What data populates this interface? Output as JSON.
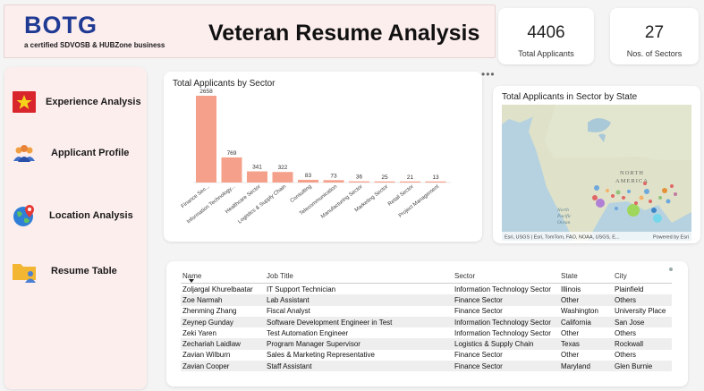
{
  "header": {
    "logo": "BOTG",
    "logo_tagline": "a certified SDVOSB & HUBZone business",
    "title": "Veteran Resume Analysis"
  },
  "kpis": [
    {
      "value": "4406",
      "label": "Total Applicants"
    },
    {
      "value": "27",
      "label": "Nos. of Sectors"
    }
  ],
  "nav": [
    {
      "label": "Experience Analysis",
      "icon": "star-flag-icon"
    },
    {
      "label": "Applicant Profile",
      "icon": "people-group-icon"
    },
    {
      "label": "Location Analysis",
      "icon": "globe-pin-icon"
    },
    {
      "label": "Resume Table",
      "icon": "folder-person-icon"
    }
  ],
  "chart_data": {
    "type": "bar",
    "title": "Total Applicants by Sector",
    "categories": [
      "Finance Sec...",
      "Information Technology...",
      "Healthcare Sector",
      "Logistics & Supply Chain",
      "Consulting",
      "Telecommunication",
      "Manufacturing Sector",
      "Marketing Sector",
      "Retail Sector",
      "Project Management"
    ],
    "values": [
      2658,
      769,
      341,
      322,
      83,
      73,
      36,
      25,
      21,
      13
    ],
    "color": "#f4a08a",
    "ylim": [
      0,
      2658
    ]
  },
  "map": {
    "title": "Total Applicants in Sector by State",
    "labels": {
      "north": "NORTH",
      "america": "AMERICA",
      "north_pacific": "North Pacific Ocean"
    },
    "attribution": "Esri, USGS | Esri, TomTom, FAO, NOAA, USGS, E...",
    "powered": "Powered by Esri"
  },
  "table": {
    "columns": [
      "Name",
      "Job Title",
      "Sector",
      "State",
      "City"
    ],
    "rows": [
      [
        "Zoljargal Khurelbaatar",
        "IT Support Technician",
        "Information Technology Sector",
        "Illinois",
        "Plainfield"
      ],
      [
        "Zoe Narmah",
        "Lab Assistant",
        "Finance Sector",
        "Other",
        "Others"
      ],
      [
        "Zhenming Zhang",
        "Fiscal Analyst",
        "Finance Sector",
        "Washington",
        "University Place"
      ],
      [
        "Zeynep Gunday",
        "Software Development Engineer in Test",
        "Information Technology Sector",
        "California",
        "San Jose"
      ],
      [
        "Zeki Yaren",
        "Test Automation Engineer",
        "Information Technology Sector",
        "Other",
        "Others"
      ],
      [
        "Zechariah Laidlaw",
        "Program Manager Supervisor",
        "Logistics & Supply Chain",
        "Texas",
        "Rockwall"
      ],
      [
        "Zavian Wilburn",
        "Sales & Marketing Representative",
        "Finance Sector",
        "Other",
        "Others"
      ],
      [
        "Zavian Cooper",
        "Staff Assistant",
        "Finance Sector",
        "Maryland",
        "Glen Burnie"
      ]
    ]
  }
}
